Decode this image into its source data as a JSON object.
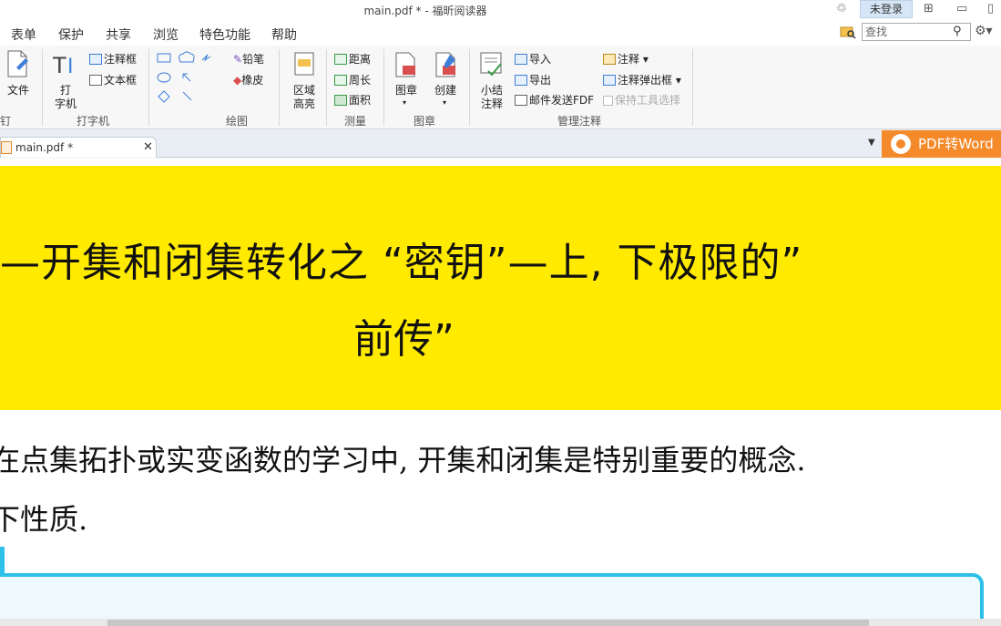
{
  "titlebar": {
    "title": "main.pdf * - 福昕阅读器",
    "login_label": "未登录"
  },
  "menu": {
    "items": [
      "表单",
      "保护",
      "共享",
      "浏览",
      "特色功能",
      "帮助"
    ]
  },
  "search": {
    "placeholder": "查找"
  },
  "ribbon": {
    "pin_group": {
      "file_label": "文件",
      "group_label": "钉"
    },
    "typewriter_group": {
      "typewriter_label_1": "打",
      "typewriter_label_2": "字机",
      "note_box": "注释框",
      "text_box": "文本框",
      "group_label": "打字机"
    },
    "draw_group": {
      "pencil": "铅笔",
      "eraser": "橡皮",
      "group_label": "绘图"
    },
    "highlight_group": {
      "area_1": "区域",
      "area_2": "高亮"
    },
    "measure_group": {
      "distance": "距离",
      "perimeter": "周长",
      "area": "面积",
      "group_label": "测量"
    },
    "stamp_group": {
      "stamp": "图章",
      "create": "创建",
      "group_label": "图章"
    },
    "manage_group": {
      "summary_1": "小结",
      "summary_2": "注释",
      "import": "导入",
      "export": "导出",
      "email_fdf": "邮件发送FDF",
      "annotation": "注释",
      "popup": "注释弹出框",
      "keep_tool": "保持工具选择",
      "group_label": "管理注释"
    }
  },
  "tabs": {
    "doc_tab_label": "main.pdf *",
    "pdf2word_label": "PDF转Word"
  },
  "document": {
    "heading_line1": "—开集和闭集转化之 “密钥”—上, 下极限的”",
    "heading_line2": "前传”",
    "body_line1": "在点集拓扑或实变函数的学习中, 开集和闭集是特别重要的概念.",
    "body_line2": "下性质."
  },
  "colors": {
    "banner": "#ffea00",
    "box_border": "#2ec0e8",
    "pdf2word": "#f58a2a"
  }
}
